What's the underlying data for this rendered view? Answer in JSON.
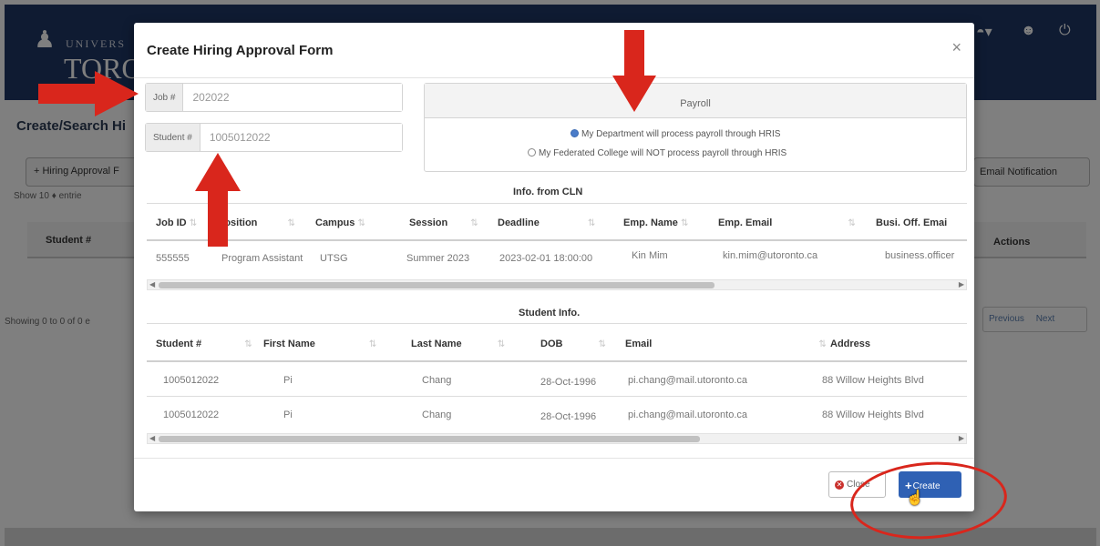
{
  "background": {
    "logo_university": "UNIVERS",
    "logo_toro": "TORO",
    "page_title": "Create/Search Hi",
    "hiring_approval_btn": "+ Hiring Approval F",
    "email_notification_btn": "Email Notification",
    "show_entries": "Show  10  ♦  entrie",
    "col_student": "Student #",
    "col_actions": "Actions",
    "showing_info": "Showing 0 to 0 of 0 e",
    "pager_previous": "Previous",
    "pager_next": "Next",
    "header_icons": [
      "user-menu-icon",
      "people-icon",
      "power-icon"
    ]
  },
  "modal": {
    "title": "Create Hiring Approval Form",
    "close_symbol": "×",
    "job_label": "Job #",
    "job_value": "202022",
    "student_label": "Student #",
    "student_value": "1005012022",
    "payroll": {
      "header": "Payroll",
      "option1": "My Department will process payroll through HRIS",
      "option2": "My Federated College will NOT process payroll through HRIS",
      "selected": "option1"
    },
    "cln": {
      "caption": "Info. from CLN",
      "headers": [
        "Job ID",
        "Position",
        "Campus",
        "Session",
        "Deadline",
        "Emp. Name",
        "Emp. Email",
        "Busi. Off. Emai"
      ],
      "rows": [
        [
          "555555",
          "Program Assistant",
          "UTSG",
          "Summer 2023",
          "2023-02-01 18:00:00",
          "Kin Mim",
          "kin.mim@utoronto.ca",
          "business.officer"
        ]
      ]
    },
    "student": {
      "caption": "Student Info.",
      "headers": [
        "Student #",
        "First Name",
        "Last Name",
        "DOB",
        "Email",
        "Address"
      ],
      "rows": [
        [
          "1005012022",
          "Pi",
          "Chang",
          "28-Oct-1996",
          "pi.chang@mail.utoronto.ca",
          "88 Willow Heights Blvd"
        ],
        [
          "1005012022",
          "Pi",
          "Chang",
          "28-Oct-1996",
          "pi.chang@mail.utoronto.ca",
          "88 Willow Heights Blvd"
        ]
      ]
    },
    "close_button": "Close",
    "create_button": "Create"
  },
  "colors": {
    "header_navy": "#1e3765",
    "primary_blue": "#2f61b4",
    "annotation_red": "#d9261c",
    "danger_red": "#c9302c"
  }
}
